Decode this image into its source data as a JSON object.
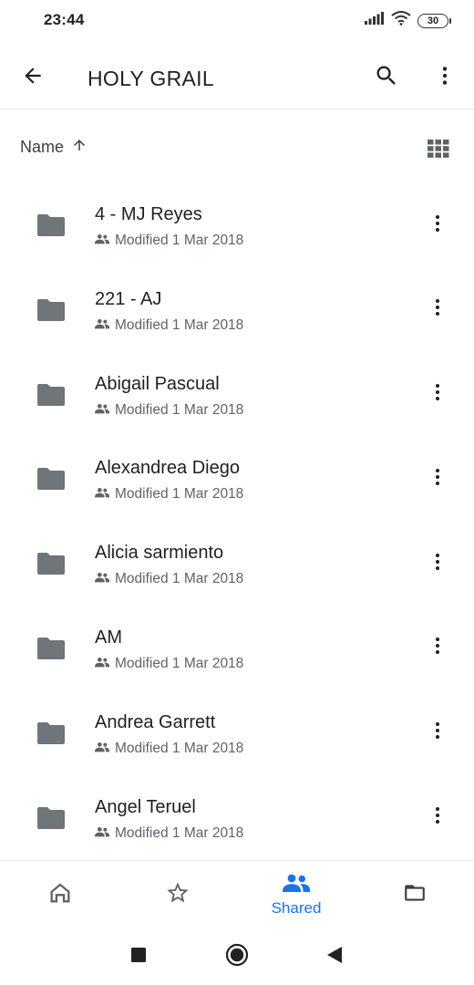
{
  "status_bar": {
    "time": "23:44",
    "battery": "30",
    "icons": [
      "signal-icon",
      "wifi-icon",
      "battery-icon"
    ]
  },
  "app_bar": {
    "title": "HOLY GRAIL",
    "icons": [
      "back-arrow-icon",
      "search-icon",
      "more-vert-icon"
    ]
  },
  "sort": {
    "label": "Name",
    "direction_icon": "arrow-up-icon",
    "view_toggle_icon": "grid-view-icon"
  },
  "files": [
    {
      "name": "4 - MJ Reyes",
      "meta": "Modified 1 Mar 2018"
    },
    {
      "name": "221 - AJ",
      "meta": "Modified 1 Mar 2018"
    },
    {
      "name": "Abigail Pascual",
      "meta": "Modified 1 Mar 2018"
    },
    {
      "name": "Alexandrea Diego",
      "meta": "Modified 1 Mar 2018"
    },
    {
      "name": "Alicia sarmiento",
      "meta": "Modified 1 Mar 2018"
    },
    {
      "name": "AM",
      "meta": "Modified 1 Mar 2018"
    },
    {
      "name": "Andrea Garrett",
      "meta": "Modified 1 Mar 2018"
    },
    {
      "name": "Angel Teruel",
      "meta": "Modified 1 Mar 2018"
    }
  ],
  "bottom_nav": {
    "items": [
      {
        "icon": "home-icon",
        "label": ""
      },
      {
        "icon": "star-icon",
        "label": ""
      },
      {
        "icon": "shared-people-icon",
        "label": "Shared",
        "active": true
      },
      {
        "icon": "folder-outline-icon",
        "label": ""
      }
    ]
  },
  "colors": {
    "accent": "#1a73e8",
    "icon_gray": "#5f6368",
    "folder_gray": "#70757a",
    "text": "#202124"
  }
}
